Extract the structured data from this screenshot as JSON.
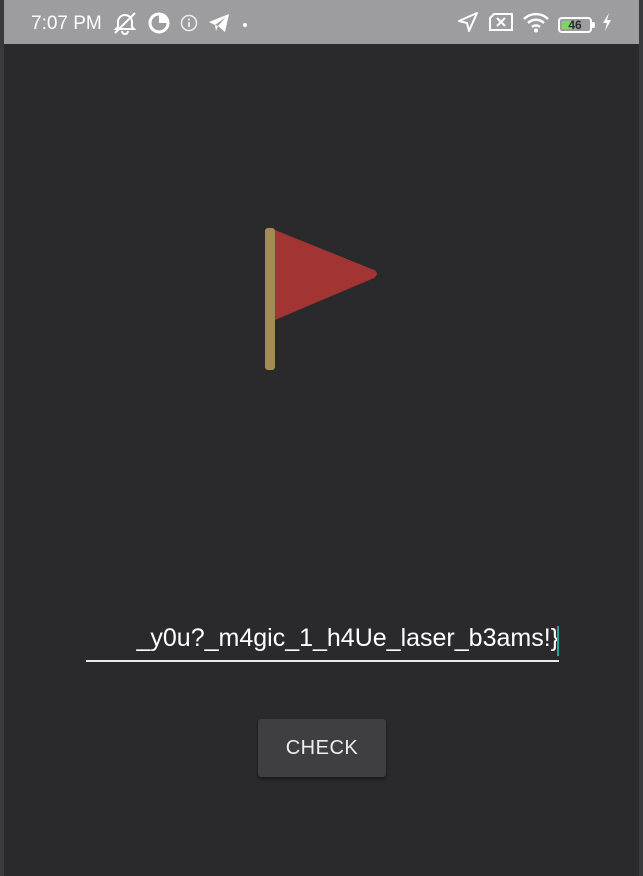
{
  "status_bar": {
    "time": "7:07 PM",
    "battery_level": "46",
    "icons_left": [
      "alarm-off-icon",
      "data-saver-icon",
      "info-icon",
      "telegram-icon",
      "dot-icon"
    ],
    "icons_right": [
      "location-icon",
      "no-sim-icon",
      "wifi-icon",
      "battery-icon",
      "charging-icon"
    ],
    "battery_color": "#7fd46a"
  },
  "main": {
    "flag_icon": "flag-icon",
    "flag_color": "#a33434",
    "pole_color": "#a38b55",
    "input_value": "_y0u?_m4gic_1_h4Ue_laser_b3ams!}",
    "check_label": "CHECK"
  },
  "colors": {
    "background": "#2a292b",
    "status_bar": "#9d9d9f",
    "button": "#3f3e40",
    "cursor": "#26a69a"
  }
}
